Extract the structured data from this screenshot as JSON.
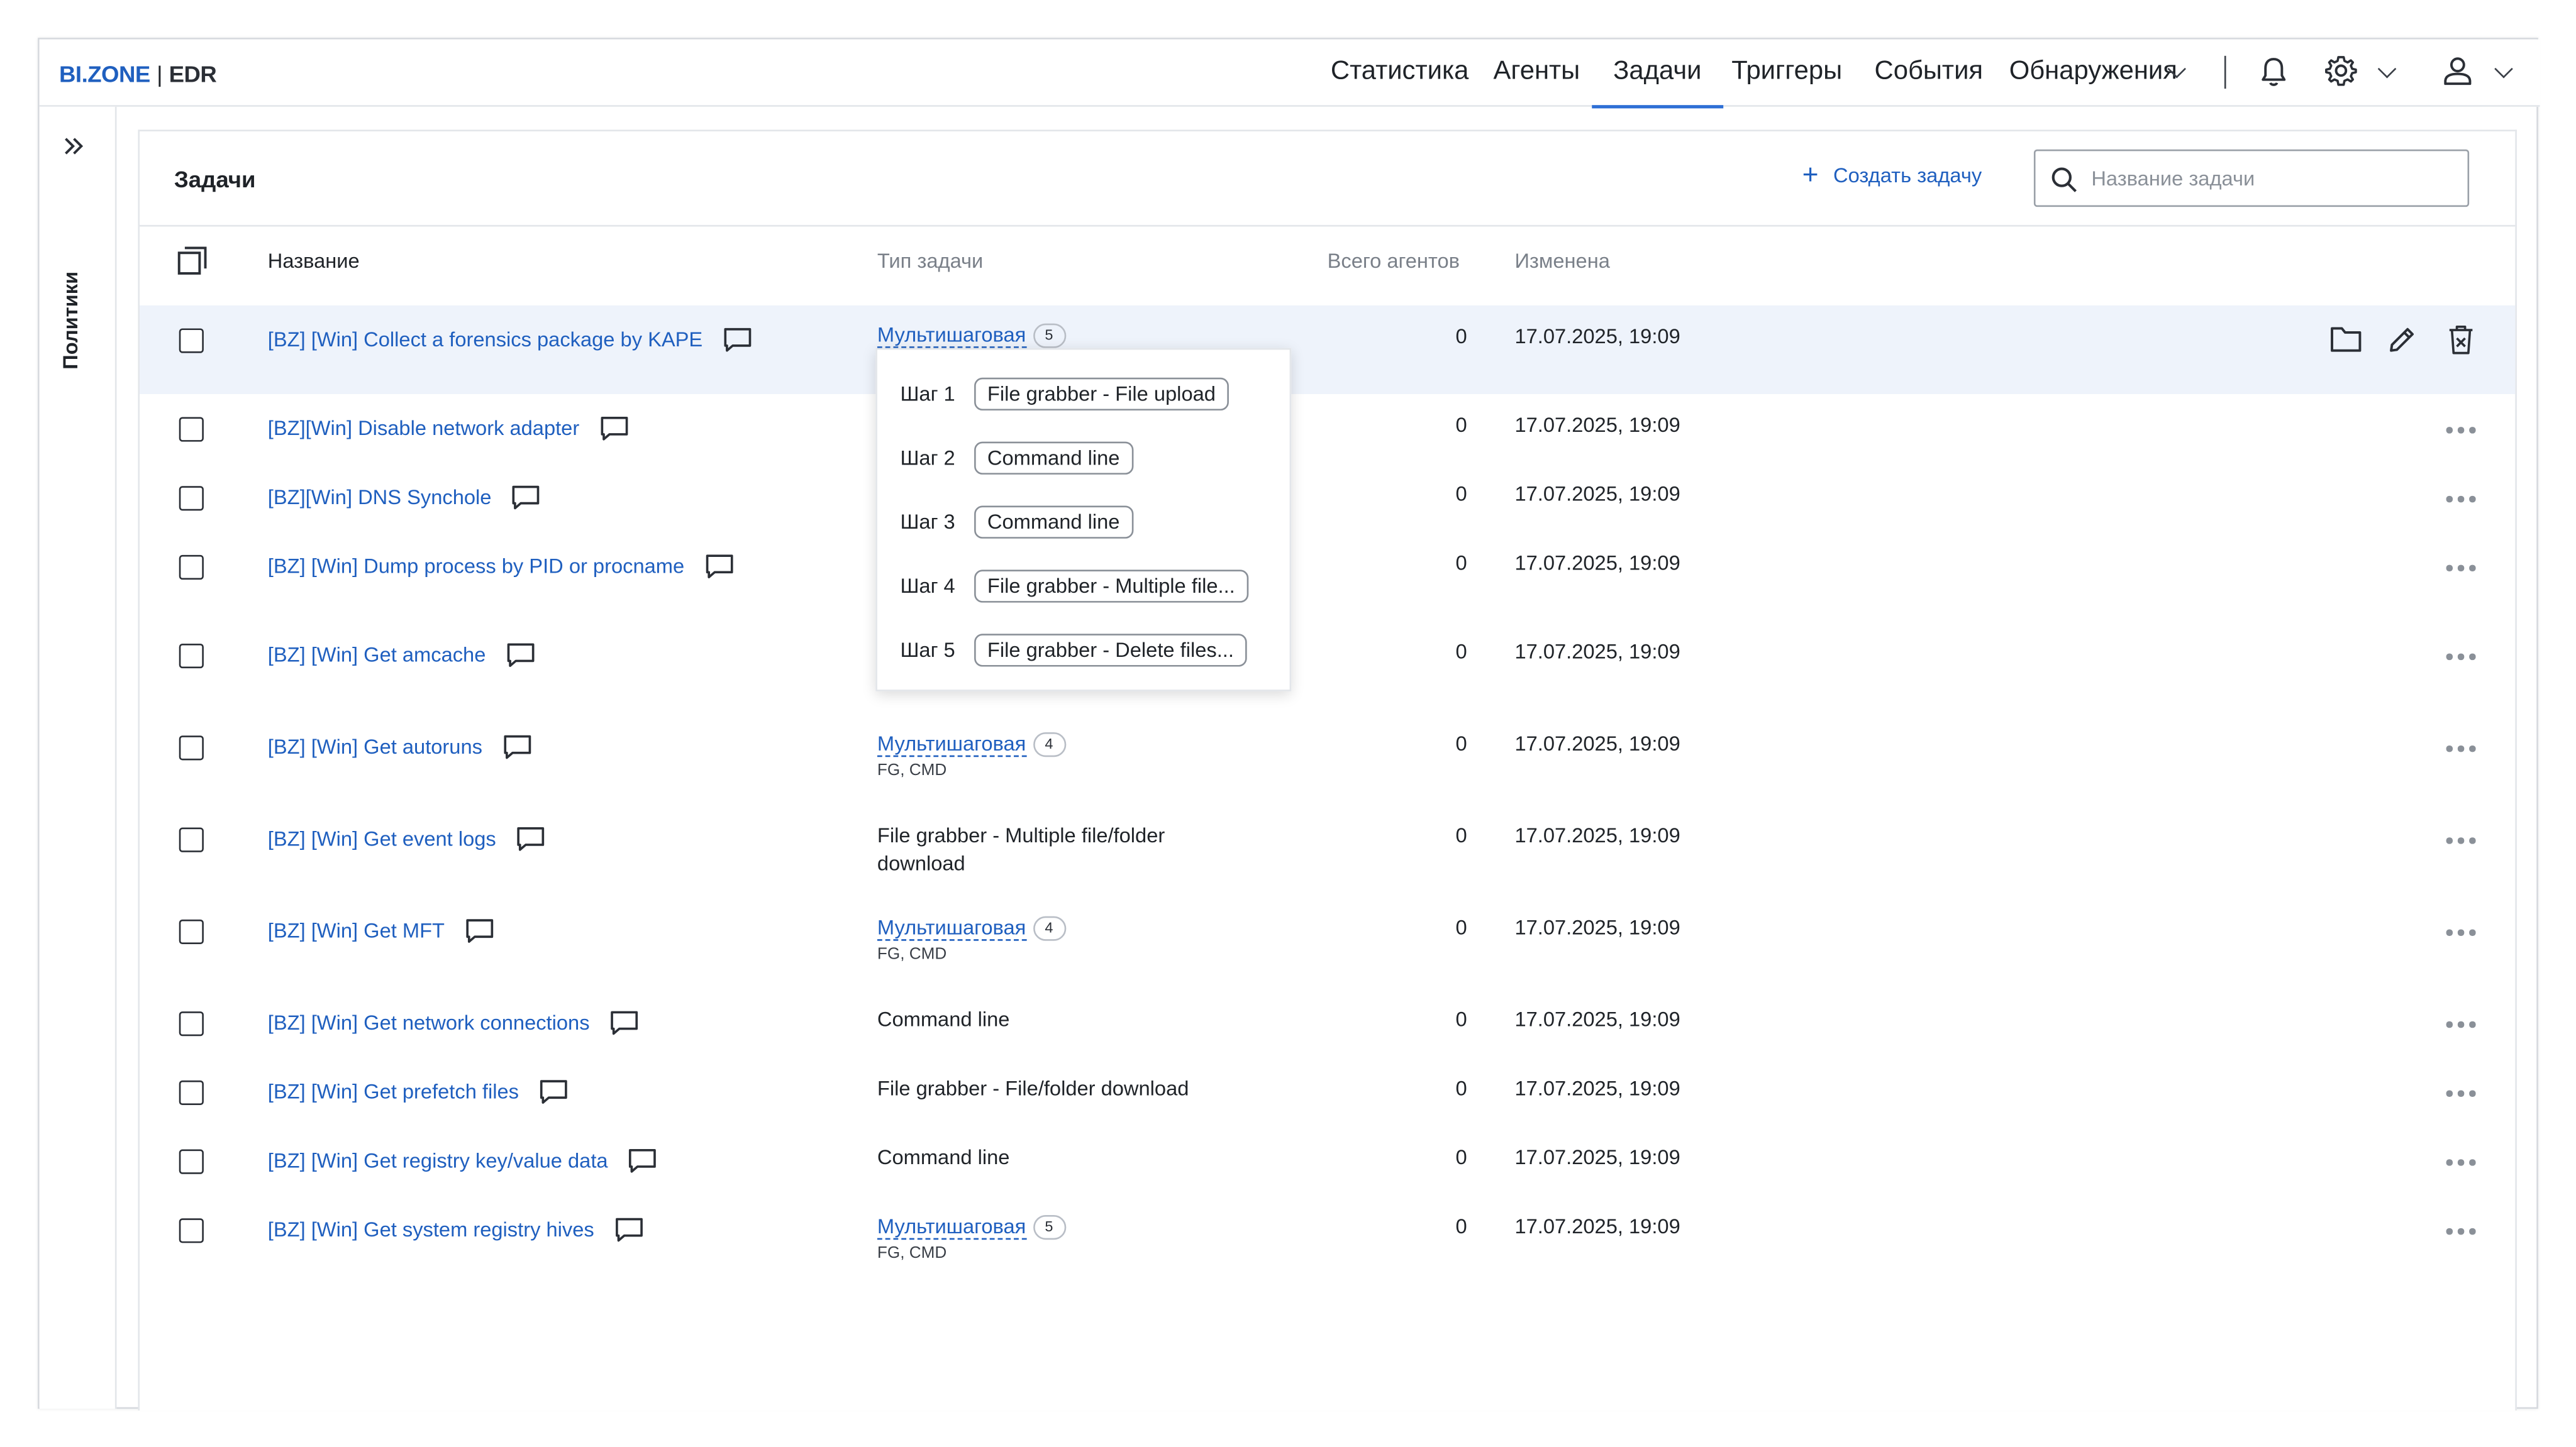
{
  "brand": {
    "logo_main": "BI.ZONE",
    "logo_sep": "|",
    "logo_product": "EDR"
  },
  "nav": {
    "items": [
      {
        "label": "Статистика"
      },
      {
        "label": "Агенты"
      },
      {
        "label": "Задачи",
        "active": true
      },
      {
        "label": "Триггеры"
      },
      {
        "label": "События"
      },
      {
        "label": "Обнаружения"
      }
    ]
  },
  "sidebar": {
    "label": "Политики"
  },
  "page": {
    "title": "Задачи",
    "create_label": "Создать задачу",
    "search_placeholder": "Название задачи"
  },
  "table": {
    "columns": {
      "name": "Название",
      "type": "Тип задачи",
      "agents": "Всего агентов",
      "changed": "Изменена"
    },
    "rows": [
      {
        "name": "[BZ] [Win] Collect a forensics package by KAPE",
        "type": "Мультишаговая",
        "count": "5",
        "sub": "",
        "agents": "0",
        "changed": "17.07.2025, 19:09"
      },
      {
        "name": "[BZ][Win] Disable network adapter",
        "type": "",
        "count": "",
        "sub": "",
        "agents": "0",
        "changed": "17.07.2025, 19:09"
      },
      {
        "name": "[BZ][Win] DNS Synchole",
        "type": "",
        "count": "",
        "sub": "",
        "agents": "0",
        "changed": "17.07.2025, 19:09"
      },
      {
        "name": "[BZ] [Win] Dump process by PID or procname",
        "type": "",
        "count": "",
        "sub": "",
        "agents": "0",
        "changed": "17.07.2025, 19:09"
      },
      {
        "name": "[BZ] [Win] Get amcache",
        "type": "",
        "count": "",
        "sub": "",
        "agents": "0",
        "changed": "17.07.2025, 19:09"
      },
      {
        "name": "[BZ] [Win] Get autoruns",
        "type": "Мультишаговая",
        "count": "4",
        "sub": "FG, CMD",
        "agents": "0",
        "changed": "17.07.2025, 19:09"
      },
      {
        "name": "[BZ] [Win] Get event logs",
        "type_line1": "File grabber - Multiple file/folder",
        "type_line2": "download",
        "agents": "0",
        "changed": "17.07.2025, 19:09"
      },
      {
        "name": "[BZ] [Win] Get MFT",
        "type": "Мультишаговая",
        "count": "4",
        "sub": "FG, CMD",
        "agents": "0",
        "changed": "17.07.2025, 19:09"
      },
      {
        "name": "[BZ] [Win] Get network connections",
        "type_plain": "Command line",
        "agents": "0",
        "changed": "17.07.2025, 19:09"
      },
      {
        "name": "[BZ] [Win] Get prefetch files",
        "type_plain": "File grabber - File/folder download",
        "agents": "0",
        "changed": "17.07.2025, 19:09"
      },
      {
        "name": "[BZ] [Win] Get registry key/value data",
        "type_plain": "Command line",
        "agents": "0",
        "changed": "17.07.2025, 19:09"
      },
      {
        "name": "[BZ] [Win] Get system registry hives",
        "type": "Мультишаговая",
        "count": "5",
        "sub": "FG, CMD",
        "agents": "0",
        "changed": "17.07.2025, 19:09"
      }
    ]
  },
  "popup": {
    "steps": [
      {
        "label": "Шаг 1",
        "value": "File grabber - File upload"
      },
      {
        "label": "Шаг 2",
        "value": "Command line"
      },
      {
        "label": "Шаг 3",
        "value": "Command line"
      },
      {
        "label": "Шаг 4",
        "value": "File grabber - Multiple file..."
      },
      {
        "label": "Шаг 5",
        "value": "File grabber - Delete files..."
      }
    ]
  },
  "icons": [
    "bell-icon",
    "gear-icon",
    "user-icon",
    "search-icon",
    "plus-icon",
    "comment-icon",
    "folder-icon",
    "pencil-icon",
    "delete-icon",
    "more-icon",
    "select-all-icon",
    "expand-icon"
  ],
  "colors": {
    "accent": "#1f5fbf",
    "active_underline": "#2d6fd6",
    "row_highlight": "#eef3fb"
  }
}
